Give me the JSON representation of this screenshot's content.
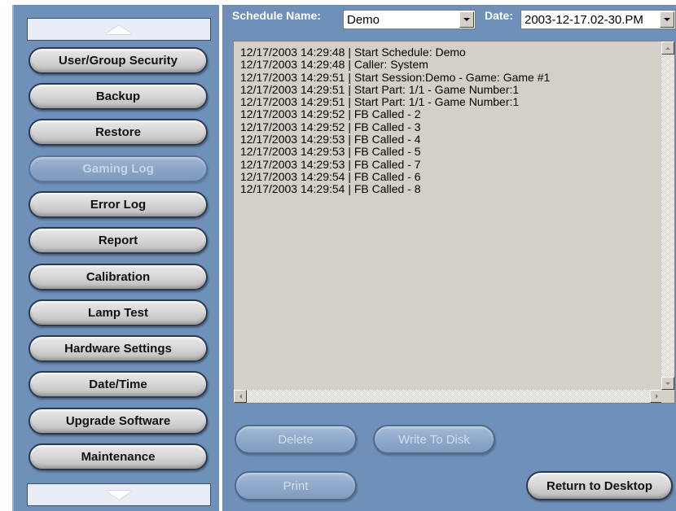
{
  "sidebar": {
    "scroll_up_icon": "triangle-up",
    "scroll_down_icon": "triangle-down",
    "items": [
      {
        "label": "User/Group Security",
        "enabled": true
      },
      {
        "label": "Backup",
        "enabled": true
      },
      {
        "label": "Restore",
        "enabled": true
      },
      {
        "label": "Gaming Log",
        "enabled": false
      },
      {
        "label": "Error Log",
        "enabled": true
      },
      {
        "label": "Report",
        "enabled": true
      },
      {
        "label": "Calibration",
        "enabled": true
      },
      {
        "label": "Lamp Test",
        "enabled": true
      },
      {
        "label": "Hardware Settings",
        "enabled": true
      },
      {
        "label": "Date/Time",
        "enabled": true
      },
      {
        "label": "Upgrade Software",
        "enabled": true
      },
      {
        "label": "Maintenance",
        "enabled": true
      }
    ]
  },
  "header": {
    "schedule_label": "Schedule Name:",
    "schedule_value": "Demo",
    "date_label": "Date:",
    "date_value": "2003-12-17.02-30.PM"
  },
  "log": {
    "lines": [
      "12/17/2003 14:29:48 | Start Schedule: Demo",
      "12/17/2003 14:29:48 | Caller: System",
      "12/17/2003 14:29:51 | Start Session:Demo - Game: Game #1",
      "12/17/2003 14:29:51 | Start Part: 1/1 - Game Number:1",
      "12/17/2003 14:29:51 | Start Part: 1/1 - Game Number:1",
      "12/17/2003 14:29:52 | FB Called - 2",
      "12/17/2003 14:29:52 | FB Called - 3",
      "12/17/2003 14:29:53 | FB Called - 4",
      "12/17/2003 14:29:53 | FB Called - 5",
      "12/17/2003 14:29:53 | FB Called - 7",
      "12/17/2003 14:29:54 | FB Called - 6",
      "12/17/2003 14:29:54 | FB Called - 8"
    ]
  },
  "actions": {
    "delete_label": "Delete",
    "write_label": "Write To Disk",
    "print_label": "Print",
    "return_label": "Return to Desktop"
  },
  "colors": {
    "panel_bg": "#6f91b9",
    "log_bg": "#d4d0c8",
    "button_face": "#d8d8d8",
    "disabled_button": "#8ea9ca"
  }
}
